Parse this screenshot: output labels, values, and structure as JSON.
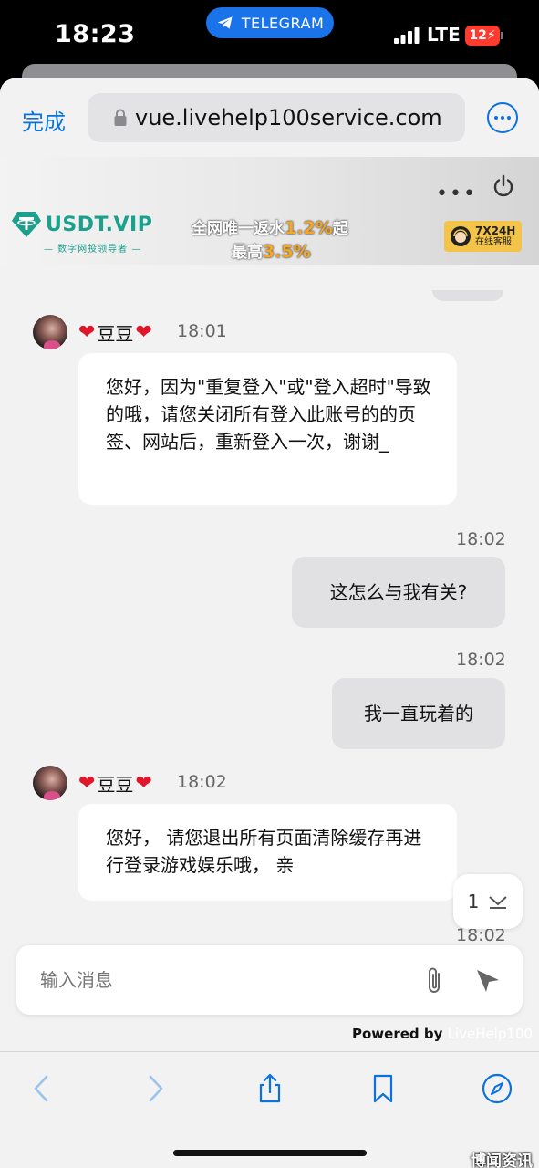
{
  "status_bar": {
    "time": "18:23",
    "app_pill": "TELEGRAM",
    "network": "LTE",
    "battery": "12"
  },
  "browser": {
    "done_label": "完成",
    "url": "vue.livehelp100service.com"
  },
  "banner": {
    "brand_name": "USDT.VIP",
    "brand_tagline": "— 数字网投领导者 —",
    "promo_line1_prefix": "全网唯一返水",
    "promo_line1_value": "1.2%",
    "promo_line1_suffix": "起",
    "promo_line2_prefix": "最高",
    "promo_line2_value": "3.5%",
    "support_line1": "7X24H",
    "support_line2": "在线客服"
  },
  "messages": [
    {
      "sender": "豆豆",
      "time": "18:01",
      "text": "您好，因为\"重复登入\"或\"登入超时\"导致的哦，请您关闭所有登入此账号的的页签、网站后，重新登入一次，谢谢_"
    },
    {
      "time": "18:02",
      "text": "这怎么与我有关?"
    },
    {
      "time": "18:02",
      "text": "我一直玩着的"
    },
    {
      "sender": "豆豆",
      "time": "18:02",
      "text": "您好， 请您退出所有页面清除缓存再进行登录游戏娱乐哦， 亲"
    },
    {
      "time": "18:02"
    }
  ],
  "scroll_badge": {
    "count": "1"
  },
  "composer": {
    "placeholder": "输入消息"
  },
  "footer": {
    "powered_by": "Powered by",
    "powered_brand": "LiveHelp100"
  },
  "watermark": "博闻资讯",
  "colors": {
    "accent": "#0a72e0",
    "brand": "#1aa08c",
    "heart": "#e0162b"
  }
}
